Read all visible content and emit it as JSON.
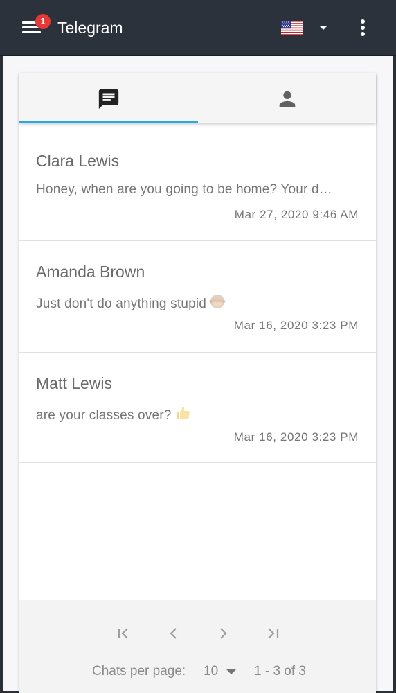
{
  "appbar": {
    "title": "Telegram",
    "notification_count": "1",
    "language": "English (US)"
  },
  "tabs": [
    {
      "id": "chats",
      "icon": "chat-icon",
      "active": true
    },
    {
      "id": "contacts",
      "icon": "person-icon",
      "active": false
    }
  ],
  "chats": [
    {
      "name": "Clara Lewis",
      "preview": "Honey, when are you going to be home? Your d…",
      "time": "Mar 27, 2020 9:46 AM",
      "emoji": ""
    },
    {
      "name": "Amanda Brown",
      "preview": "Just don't do anything stupid",
      "time": "Mar 16, 2020 3:23 PM",
      "emoji": "see-no-evil-monkey"
    },
    {
      "name": "Matt Lewis",
      "preview": "are your classes over?",
      "time": "Mar 16, 2020 3:23 PM",
      "emoji": "thumbs-up"
    }
  ],
  "pagination": {
    "per_page_label": "Chats per page:",
    "per_page_value": "10",
    "range": "1 - 3 of 3"
  },
  "colors": {
    "appbar_bg": "#2b323b",
    "badge": "#e53935",
    "tab_indicator": "#29a8e0",
    "text_secondary": "#757575"
  }
}
